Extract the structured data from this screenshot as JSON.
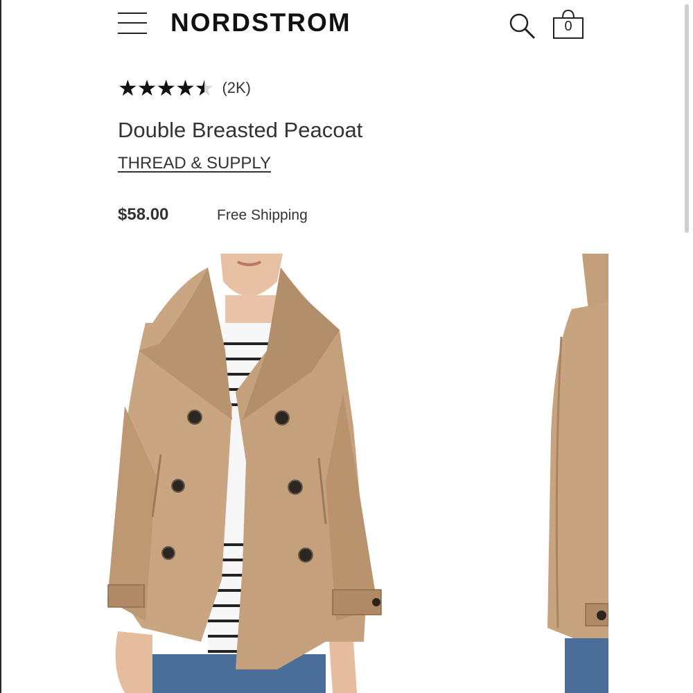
{
  "header": {
    "menu_icon": "hamburger-menu-icon",
    "logo": "NORDSTROM",
    "search_icon": "search-icon",
    "bag_icon": "shopping-bag-icon",
    "bag_count": "0"
  },
  "product": {
    "rating_value": 4.5,
    "rating_max": 5,
    "rating_count": "(2K)",
    "title": "Double Breasted Peacoat",
    "brand": "THREAD & SUPPLY",
    "price": "$58.00",
    "shipping": "Free Shipping"
  },
  "gallery": {
    "images": [
      {
        "name": "coat-front-photo"
      },
      {
        "name": "coat-side-photo"
      }
    ]
  },
  "colors": {
    "coat": "#c9a582",
    "coat_shadow": "#a9855f",
    "text": "#333333"
  }
}
